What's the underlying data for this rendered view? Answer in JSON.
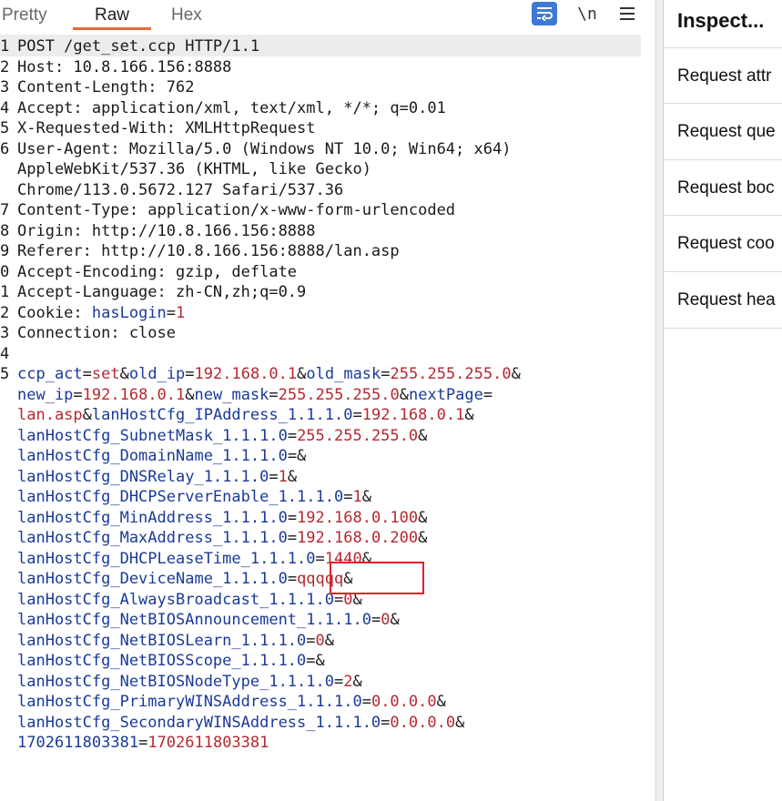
{
  "tabs": [
    {
      "label": "Pretty",
      "active": false
    },
    {
      "label": "Raw",
      "active": true
    },
    {
      "label": "Hex",
      "active": false
    }
  ],
  "toolbar": {
    "wrap_icon": "wrap-lines-icon",
    "newline_label": "\\n",
    "menu_icon": "hamburger-menu-icon"
  },
  "colors": {
    "accent": "#e8693a",
    "key": "#1a3a9a",
    "value": "#b5282f",
    "highlight": "#e0222a"
  },
  "inspector": {
    "title": "Inspect...",
    "items": [
      "Request attr",
      "Request que",
      "Request boc",
      "Request coo",
      "Request hea"
    ]
  },
  "lines": [
    {
      "n": "1",
      "segs": [
        {
          "t": "POST /get_set.ccp HTTP/1.1",
          "c": "p"
        }
      ]
    },
    {
      "n": "2",
      "segs": [
        {
          "t": "Host: 10.8.166.156:8888",
          "c": "p"
        }
      ]
    },
    {
      "n": "3",
      "segs": [
        {
          "t": "Content-Length: 762",
          "c": "p"
        }
      ]
    },
    {
      "n": "4",
      "segs": [
        {
          "t": "Accept: application/xml, text/xml, */*; q=0.01",
          "c": "p"
        }
      ]
    },
    {
      "n": "5",
      "segs": [
        {
          "t": "X-Requested-With: XMLHttpRequest",
          "c": "p"
        }
      ]
    },
    {
      "n": "6",
      "segs": [
        {
          "t": "User-Agent: Mozilla/5.0 (Windows NT 10.0; Win64; x64)",
          "c": "p"
        }
      ]
    },
    {
      "n": "",
      "segs": [
        {
          "t": "AppleWebKit/537.36 (KHTML, like Gecko)",
          "c": "p"
        }
      ]
    },
    {
      "n": "",
      "segs": [
        {
          "t": "Chrome/113.0.5672.127 Safari/537.36",
          "c": "p"
        }
      ]
    },
    {
      "n": "7",
      "segs": [
        {
          "t": "Content-Type: application/x-www-form-urlencoded",
          "c": "p"
        }
      ]
    },
    {
      "n": "8",
      "segs": [
        {
          "t": "Origin: http://10.8.166.156:8888",
          "c": "p"
        }
      ]
    },
    {
      "n": "9",
      "segs": [
        {
          "t": "Referer: http://10.8.166.156:8888/lan.asp",
          "c": "p"
        }
      ]
    },
    {
      "n": "0",
      "segs": [
        {
          "t": "Accept-Encoding: gzip, deflate",
          "c": "p"
        }
      ]
    },
    {
      "n": "1",
      "segs": [
        {
          "t": "Accept-Language: zh-CN,zh;q=0.9",
          "c": "p"
        }
      ]
    },
    {
      "n": "2",
      "segs": [
        {
          "t": "Cookie: ",
          "c": "p"
        },
        {
          "t": "hasLogin",
          "c": "k"
        },
        {
          "t": "=",
          "c": "p"
        },
        {
          "t": "1",
          "c": "v"
        }
      ]
    },
    {
      "n": "3",
      "segs": [
        {
          "t": "Connection: close",
          "c": "p"
        }
      ]
    },
    {
      "n": "4",
      "segs": [
        {
          "t": "",
          "c": "p"
        }
      ]
    },
    {
      "n": "5",
      "segs": [
        {
          "t": "ccp_act",
          "c": "k"
        },
        {
          "t": "=",
          "c": "p"
        },
        {
          "t": "set",
          "c": "v"
        },
        {
          "t": "&",
          "c": "p"
        },
        {
          "t": "old_ip",
          "c": "k"
        },
        {
          "t": "=",
          "c": "p"
        },
        {
          "t": "192.168.0.1",
          "c": "v"
        },
        {
          "t": "&",
          "c": "p"
        },
        {
          "t": "old_mask",
          "c": "k"
        },
        {
          "t": "=",
          "c": "p"
        },
        {
          "t": "255.255.255.0",
          "c": "v"
        },
        {
          "t": "&",
          "c": "p"
        }
      ]
    },
    {
      "n": "",
      "segs": [
        {
          "t": "new_ip",
          "c": "k"
        },
        {
          "t": "=",
          "c": "p"
        },
        {
          "t": "192.168.0.1",
          "c": "v"
        },
        {
          "t": "&",
          "c": "p"
        },
        {
          "t": "new_mask",
          "c": "k"
        },
        {
          "t": "=",
          "c": "p"
        },
        {
          "t": "255.255.255.0",
          "c": "v"
        },
        {
          "t": "&",
          "c": "p"
        },
        {
          "t": "nextPage",
          "c": "k"
        },
        {
          "t": "=",
          "c": "p"
        }
      ]
    },
    {
      "n": "",
      "segs": [
        {
          "t": "lan.asp",
          "c": "v"
        },
        {
          "t": "&",
          "c": "p"
        },
        {
          "t": "lanHostCfg_IPAddress_1.1.1.0",
          "c": "k"
        },
        {
          "t": "=",
          "c": "p"
        },
        {
          "t": "192.168.0.1",
          "c": "v"
        },
        {
          "t": "&",
          "c": "p"
        }
      ]
    },
    {
      "n": "",
      "segs": [
        {
          "t": "lanHostCfg_SubnetMask_1.1.1.0",
          "c": "k"
        },
        {
          "t": "=",
          "c": "p"
        },
        {
          "t": "255.255.255.0",
          "c": "v"
        },
        {
          "t": "&",
          "c": "p"
        }
      ]
    },
    {
      "n": "",
      "segs": [
        {
          "t": "lanHostCfg_DomainName_1.1.1.0",
          "c": "k"
        },
        {
          "t": "=&",
          "c": "p"
        }
      ]
    },
    {
      "n": "",
      "segs": [
        {
          "t": "lanHostCfg_DNSRelay_1.1.1.0",
          "c": "k"
        },
        {
          "t": "=",
          "c": "p"
        },
        {
          "t": "1",
          "c": "v"
        },
        {
          "t": "&",
          "c": "p"
        }
      ]
    },
    {
      "n": "",
      "segs": [
        {
          "t": "lanHostCfg_DHCPServerEnable_1.1.1.0",
          "c": "k"
        },
        {
          "t": "=",
          "c": "p"
        },
        {
          "t": "1",
          "c": "v"
        },
        {
          "t": "&",
          "c": "p"
        }
      ]
    },
    {
      "n": "",
      "segs": [
        {
          "t": "lanHostCfg_MinAddress_1.1.1.0",
          "c": "k"
        },
        {
          "t": "=",
          "c": "p"
        },
        {
          "t": "192.168.0.100",
          "c": "v"
        },
        {
          "t": "&",
          "c": "p"
        }
      ]
    },
    {
      "n": "",
      "segs": [
        {
          "t": "lanHostCfg_MaxAddress_1.1.1.0",
          "c": "k"
        },
        {
          "t": "=",
          "c": "p"
        },
        {
          "t": "192.168.0.200",
          "c": "v"
        },
        {
          "t": "&",
          "c": "p"
        }
      ]
    },
    {
      "n": "",
      "segs": [
        {
          "t": "lanHostCfg_DHCPLeaseTime_1.1.1.0",
          "c": "k"
        },
        {
          "t": "=",
          "c": "p"
        },
        {
          "t": "1440",
          "c": "v"
        },
        {
          "t": "&",
          "c": "p"
        }
      ]
    },
    {
      "n": "",
      "segs": [
        {
          "t": "lanHostCfg_DeviceName_1.1.1.0",
          "c": "k"
        },
        {
          "t": "=",
          "c": "p"
        },
        {
          "t": "qqqqq",
          "c": "v"
        },
        {
          "t": "&",
          "c": "p"
        }
      ]
    },
    {
      "n": "",
      "segs": [
        {
          "t": "lanHostCfg_AlwaysBroadcast_1.1.1.0",
          "c": "k"
        },
        {
          "t": "=",
          "c": "p"
        },
        {
          "t": "0",
          "c": "v"
        },
        {
          "t": "&",
          "c": "p"
        }
      ]
    },
    {
      "n": "",
      "segs": [
        {
          "t": "lanHostCfg_NetBIOSAnnouncement_1.1.1.0",
          "c": "k"
        },
        {
          "t": "=",
          "c": "p"
        },
        {
          "t": "0",
          "c": "v"
        },
        {
          "t": "&",
          "c": "p"
        }
      ]
    },
    {
      "n": "",
      "segs": [
        {
          "t": "lanHostCfg_NetBIOSLearn_1.1.1.0",
          "c": "k"
        },
        {
          "t": "=",
          "c": "p"
        },
        {
          "t": "0",
          "c": "v"
        },
        {
          "t": "&",
          "c": "p"
        }
      ]
    },
    {
      "n": "",
      "segs": [
        {
          "t": "lanHostCfg_NetBIOSScope_1.1.1.0",
          "c": "k"
        },
        {
          "t": "=&",
          "c": "p"
        }
      ]
    },
    {
      "n": "",
      "segs": [
        {
          "t": "lanHostCfg_NetBIOSNodeType_1.1.1.0",
          "c": "k"
        },
        {
          "t": "=",
          "c": "p"
        },
        {
          "t": "2",
          "c": "v"
        },
        {
          "t": "&",
          "c": "p"
        }
      ]
    },
    {
      "n": "",
      "segs": [
        {
          "t": "lanHostCfg_PrimaryWINSAddress_1.1.1.0",
          "c": "k"
        },
        {
          "t": "=",
          "c": "p"
        },
        {
          "t": "0.0.0.0",
          "c": "v"
        },
        {
          "t": "&",
          "c": "p"
        }
      ]
    },
    {
      "n": "",
      "segs": [
        {
          "t": "lanHostCfg_SecondaryWINSAddress_1.1.1.0",
          "c": "k"
        },
        {
          "t": "=",
          "c": "p"
        },
        {
          "t": "0.0.0.0",
          "c": "v"
        },
        {
          "t": "&",
          "c": "p"
        }
      ]
    },
    {
      "n": "",
      "segs": [
        {
          "t": "1702611803381",
          "c": "k"
        },
        {
          "t": "=",
          "c": "p"
        },
        {
          "t": "1702611803381",
          "c": "v"
        }
      ]
    }
  ]
}
